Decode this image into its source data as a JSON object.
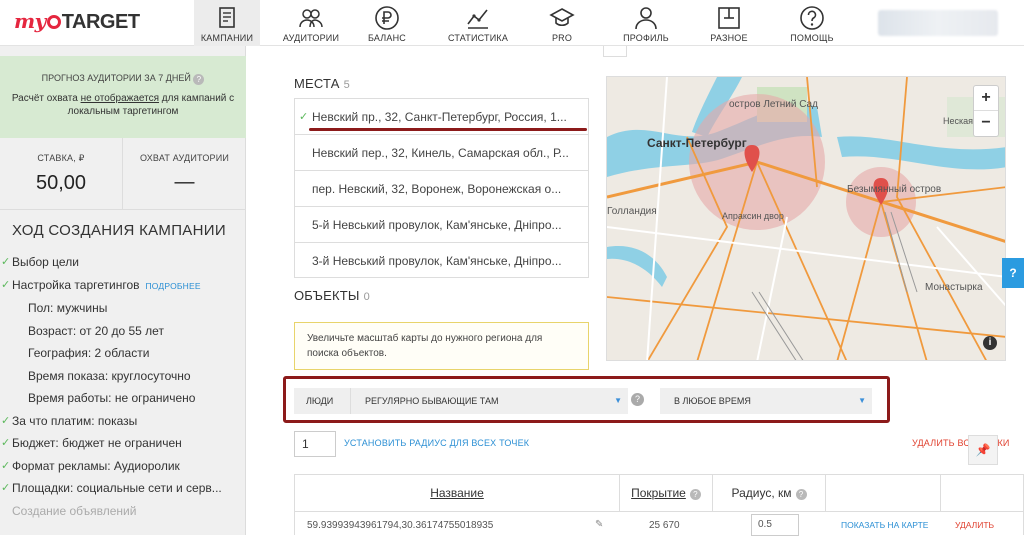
{
  "logo": {
    "my": "my",
    "target": "TARGET"
  },
  "nav": [
    {
      "label": "КАМПАНИИ",
      "icon": "campaigns-icon",
      "active": true
    },
    {
      "label": "АУДИТОРИИ",
      "icon": "audiences-icon"
    },
    {
      "label": "БАЛАНС",
      "icon": "ruble-icon"
    },
    {
      "label": "СТАТИСТИКА",
      "icon": "stats-chart-icon"
    },
    {
      "label": "PRO",
      "icon": "graduation-cap-icon"
    },
    {
      "label": "ПРОФИЛЬ",
      "icon": "profile-icon"
    },
    {
      "label": "РАЗНОЕ",
      "icon": "misc-icon"
    },
    {
      "label": "ПОМОЩЬ",
      "icon": "help-icon"
    }
  ],
  "sidebar": {
    "forecast_title": "ПРОГНОЗ АУДИТОРИИ ЗА 7 ДНЕЙ",
    "forecast_q": "?",
    "forecast_desc_1": "Расчёт охвата ",
    "forecast_desc_u": "не отображается",
    "forecast_desc_2": " для кампаний с локальным таргетингом",
    "bid_label": "СТАВКА, ₽",
    "bid_value": "50,00",
    "reach_label": "ОХВАТ АУДИТОРИИ",
    "reach_value": "—",
    "progress_title": "ХОД СОЗДАНИЯ КАМПАНИИ",
    "steps": [
      {
        "type": "done",
        "text": "Выбор цели"
      },
      {
        "type": "done",
        "text": "Настройка таргетингов",
        "more": "ПОДРОБНЕЕ"
      },
      {
        "type": "sub",
        "text": "Пол: мужчины"
      },
      {
        "type": "sub",
        "text": "Возраст: от 20 до 55 лет"
      },
      {
        "type": "sub",
        "text": "География: 2 области"
      },
      {
        "type": "sub",
        "text": "Время показа: круглосуточно"
      },
      {
        "type": "sub",
        "text": "Время работы: не ограничено"
      },
      {
        "type": "done",
        "text": "За что платим: показы"
      },
      {
        "type": "done",
        "text": "Бюджет: бюджет не ограничен"
      },
      {
        "type": "done",
        "text": "Формат рекламы: Аудиоролик"
      },
      {
        "type": "done",
        "text": "Площадки: социальные сети и серв..."
      },
      {
        "type": "muted",
        "text": "Создание объявлений"
      }
    ]
  },
  "places": {
    "title": "МЕСТА",
    "count": "5",
    "items": [
      "Невский пр., 32, Санкт-Петербург, Россия, 1...",
      "Невский пер., 32, Кинель, Самарская обл., Р...",
      "пер. Невский, 32, Воронеж, Воронежская о...",
      "5-й Невський провулок, Кам'янське, Дніпро...",
      "3-й Невський провулок, Кам'янське, Дніпро..."
    ]
  },
  "objects": {
    "title": "ОБЪЕКТЫ",
    "count": "0",
    "notice": "Увеличьте масштаб карты до нужного региона для поиска объектов."
  },
  "map": {
    "labels": {
      "spb": "Санкт-Петербург",
      "letniy": "остров Летний Сад",
      "bezymyanny": "Безымянный остров",
      "gollandia": "Голландия",
      "apraksin": "Апраксин двор",
      "monastyrka": "Монастырка",
      "neskaya": "Неская"
    },
    "zoom_in": "+",
    "zoom_out": "−",
    "info": "i"
  },
  "filters": {
    "who": "ЛЮДИ",
    "mode": "РЕГУЛЯРНО БЫВАЮЩИЕ ТАМ",
    "q": "?",
    "time": "В ЛЮБОЕ ВРЕМЯ"
  },
  "radius": {
    "value": "1",
    "set_all": "УСТАНОВИТЬ РАДИУС ДЛЯ ВСЕХ ТОЧЕК",
    "delete_all": "УДАЛИТЬ ВСЕ ТОЧКИ"
  },
  "table": {
    "col_name": "Название",
    "col_coverage": "Покрытие",
    "col_radius": "Радиус, км",
    "q": "?",
    "row_name": "59.93993943961794,30.36174755018935",
    "row_coverage": "25 670",
    "row_radius": "0.5",
    "row_show": "ПОКАЗАТЬ НА КАРТЕ",
    "row_delete": "УДАЛИТЬ"
  },
  "help_tab": "?",
  "colors": {
    "accent": "#2b8fd4",
    "brand_red": "#e5263f",
    "highlight": "#8c1a1a",
    "ok": "#5cb85c"
  }
}
